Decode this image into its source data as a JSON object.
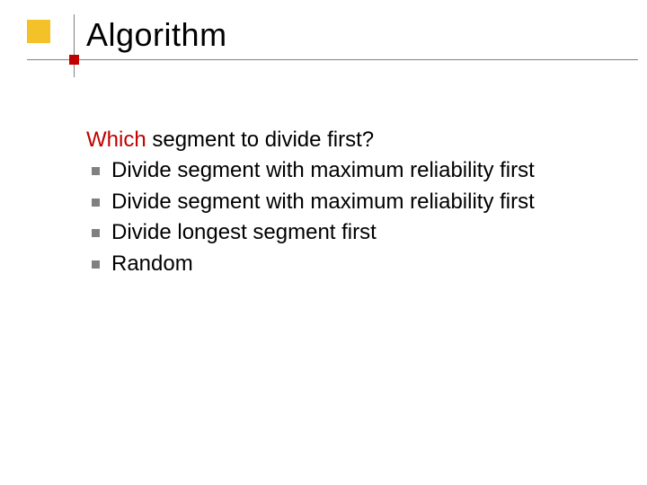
{
  "title": "Algorithm",
  "question": {
    "first_word": "Which",
    "rest": " segment to divide first?"
  },
  "bullets": [
    "Divide segment with maximum reliability first",
    "Divide segment with maximum reliability first",
    "Divide longest segment first",
    "Random"
  ]
}
